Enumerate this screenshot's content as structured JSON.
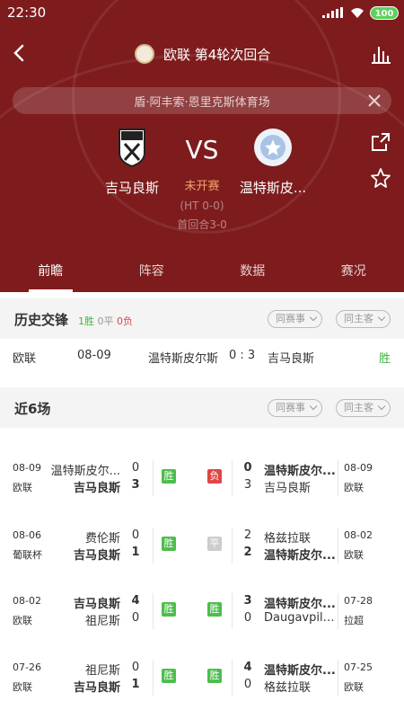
{
  "status_bar": {
    "time": "22:30",
    "battery": "100"
  },
  "nav": {
    "title": "欧联 第4轮次回合"
  },
  "venue": "盾·阿丰索·恩里克斯体育场",
  "match": {
    "home": "吉马良斯",
    "away": "温特斯皮...",
    "vs": "VS",
    "status": "未开赛",
    "ht": "(HT 0-0)",
    "first_leg": "首回合3-0"
  },
  "tabs": [
    "前瞻",
    "阵容",
    "数据",
    "赛况"
  ],
  "history": {
    "title": "历史交锋",
    "win": "1胜",
    "draw": "0平",
    "loss": "0负",
    "chip1": "同赛事",
    "chip2": "同主客",
    "row": {
      "league": "欧联",
      "date": "08-09",
      "home": "温特斯皮尔斯",
      "score": "0 : 3",
      "away": "吉马良斯",
      "result": "胜"
    }
  },
  "recent": {
    "title": "近6场",
    "chip1": "同赛事",
    "chip2": "同主客",
    "rows": [
      {
        "l_date": "08-09",
        "l_league": "欧联",
        "l_t1": "温特斯皮尔...",
        "l_s1": "0",
        "l_t2": "吉马良斯",
        "l_s2": "3",
        "l_res": "胜",
        "r_res": "负",
        "r_s1": "0",
        "r_t1": "温特斯皮尔...",
        "r_s2": "3",
        "r_t2": "吉马良斯",
        "r_date": "08-09",
        "r_league": "欧联"
      },
      {
        "l_date": "08-06",
        "l_league": "葡联杯",
        "l_t1": "费伦斯",
        "l_s1": "0",
        "l_t2": "吉马良斯",
        "l_s2": "1",
        "l_res": "胜",
        "r_res": "平",
        "r_s1": "2",
        "r_t1": "格兹拉联",
        "r_s2": "2",
        "r_t2": "温特斯皮尔...",
        "r_date": "08-02",
        "r_league": "欧联"
      },
      {
        "l_date": "08-02",
        "l_league": "欧联",
        "l_t1": "吉马良斯",
        "l_s1": "4",
        "l_t2": "祖尼斯",
        "l_s2": "0",
        "l_res": "胜",
        "r_res": "胜",
        "r_s1": "3",
        "r_t1": "温特斯皮尔...",
        "r_s2": "0",
        "r_t2": "Daugavpils ...",
        "r_date": "07-28",
        "r_league": "拉超"
      },
      {
        "l_date": "07-26",
        "l_league": "欧联",
        "l_t1": "祖尼斯",
        "l_s1": "0",
        "l_t2": "吉马良斯",
        "l_s2": "1",
        "l_res": "胜",
        "r_res": "胜",
        "r_s1": "4",
        "r_t1": "温特斯皮尔...",
        "r_s2": "0",
        "r_t2": "格兹拉联",
        "r_date": "07-25",
        "r_league": "欧联"
      }
    ]
  }
}
